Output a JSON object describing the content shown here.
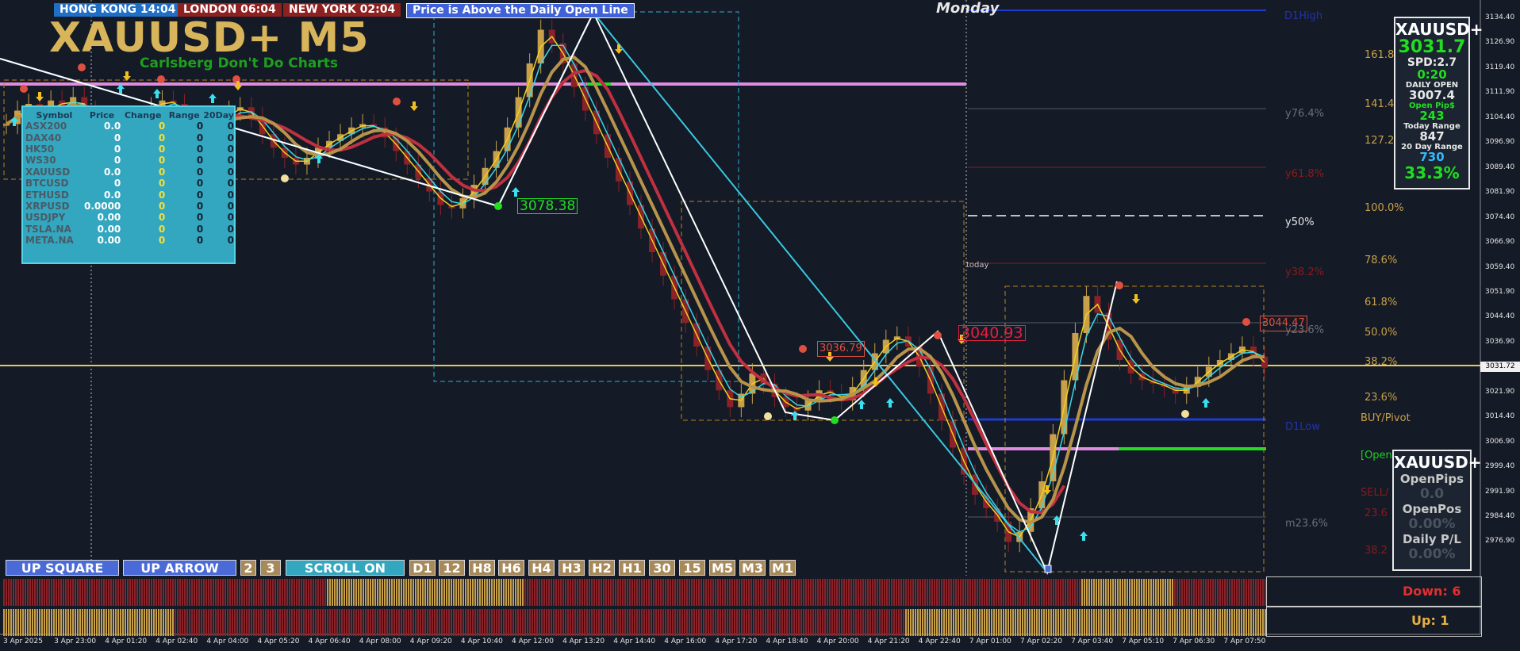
{
  "chart": {
    "symbol_title": "XAUUSD+ M5",
    "tagline": "Carlsberg Don't Do Charts",
    "day_label": "Monday",
    "today_label": "today",
    "current_price_label": "3031.72"
  },
  "sessions": [
    {
      "label": "HONG KONG 14:04",
      "color": "#1f6fc6"
    },
    {
      "label": "LONDON  06:04",
      "color": "#8e2020"
    },
    {
      "label": "NEW YORK  02:04",
      "color": "#8e2020"
    },
    {
      "label": "Price is Above the Daily Open Line",
      "color": "#4062d8"
    }
  ],
  "market_table": {
    "headers": [
      "Symbol",
      "Price",
      "Change",
      "Range",
      "20Day"
    ],
    "rows": [
      {
        "symbol": "ASX200",
        "price": "0.0",
        "change": "0",
        "range": "0",
        "day20": "0"
      },
      {
        "symbol": "DAX40",
        "price": "0",
        "change": "0",
        "range": "0",
        "day20": "0"
      },
      {
        "symbol": "HK50",
        "price": "0",
        "change": "0",
        "range": "0",
        "day20": "0"
      },
      {
        "symbol": "WS30",
        "price": "0",
        "change": "0",
        "range": "0",
        "day20": "0"
      },
      {
        "symbol": "XAUUSD",
        "price": "0.0",
        "change": "0",
        "range": "0",
        "day20": "0"
      },
      {
        "symbol": "BTCUSD",
        "price": "0",
        "change": "0",
        "range": "0",
        "day20": "0"
      },
      {
        "symbol": "ETHUSD",
        "price": "0.0",
        "change": "0",
        "range": "0",
        "day20": "0"
      },
      {
        "symbol": "XRPUSD",
        "price": "0.0000",
        "change": "0",
        "range": "0",
        "day20": "0"
      },
      {
        "symbol": "USDJPY",
        "price": "0.00",
        "change": "0",
        "range": "0",
        "day20": "0"
      },
      {
        "symbol": "TSLA.NA",
        "price": "0.00",
        "change": "0",
        "range": "0",
        "day20": "0"
      },
      {
        "symbol": "META.NA",
        "price": "0.00",
        "change": "0",
        "range": "0",
        "day20": "0"
      }
    ]
  },
  "info_panel": {
    "symbol": "XAUUSD+",
    "price": "3031.7",
    "spread": "SPD:2.7",
    "timer": "0:20",
    "daily_open_label": "DAILY OPEN",
    "daily_open": "3007.4",
    "open_pips_label": "Open Pip$",
    "open_pips": "243",
    "today_range_label": "Today Range",
    "today_range": "847",
    "day20_range_label": "20 Day Range",
    "day20_range": "730",
    "percent": "33.3%"
  },
  "position_panel": {
    "symbol": "XAUUSD+",
    "open_pips_label": "OpenPips",
    "open_pips": "0.0",
    "open_pos_label": "OpenPos",
    "open_pos": "0.00%",
    "daily_pl_label": "Daily P/L",
    "daily_pl": "0.00%"
  },
  "toolbar": {
    "mode_buttons": [
      "UP SQUARE",
      "UP ARROW",
      "2",
      "3",
      "SCROLL ON"
    ],
    "timeframes": [
      "D1",
      "12",
      "H8",
      "H6",
      "H4",
      "H3",
      "H2",
      "H1",
      "30",
      "15",
      "M5",
      "M3",
      "M1"
    ]
  },
  "strength": {
    "down_label": "Down: 6",
    "up_label": "Up: 1"
  },
  "price_axis": {
    "labels": [
      "3134.40",
      "3126.90",
      "3119.40",
      "3111.90",
      "3104.40",
      "3096.90",
      "3089.40",
      "3081.90",
      "3074.40",
      "3066.90",
      "3059.40",
      "3051.90",
      "3044.40",
      "3036.90",
      "3029.40",
      "3021.90",
      "3014.40",
      "3006.90",
      "2999.40",
      "2991.90",
      "2984.40",
      "2976.90"
    ]
  },
  "time_axis": {
    "labels": [
      "3 Apr 2025",
      "3 Apr 23:00",
      "4 Apr 01:20",
      "4 Apr 02:40",
      "4 Apr 04:00",
      "4 Apr 05:20",
      "4 Apr 06:40",
      "4 Apr 08:00",
      "4 Apr 09:20",
      "4 Apr 10:40",
      "4 Apr 12:00",
      "4 Apr 13:20",
      "4 Apr 14:40",
      "4 Apr 16:00",
      "4 Apr 17:20",
      "4 Apr 18:40",
      "4 Apr 20:00",
      "4 Apr 21:20",
      "4 Apr 22:40",
      "7 Apr 01:00",
      "7 Apr 02:20",
      "7 Apr 03:40",
      "7 Apr 05:10",
      "7 Apr 06:30",
      "7 Apr 07:50"
    ]
  },
  "fib_levels": [
    {
      "label": "D1High",
      "color": "#2233aa"
    },
    {
      "label": "161.8",
      "color": "#c8a04a"
    },
    {
      "label": "y76.4%",
      "color": "#6b7078"
    },
    {
      "label": "141.4",
      "color": "#c8a04a"
    },
    {
      "label": "127.2",
      "color": "#c8a04a"
    },
    {
      "label": "y61.8%",
      "color": "#8a1a1a"
    },
    {
      "label": "100.0%",
      "color": "#c8a04a"
    },
    {
      "label": "y50%",
      "color": "#e8e8e8"
    },
    {
      "label": "78.6%",
      "color": "#c8a04a"
    },
    {
      "label": "y38.2%",
      "color": "#8a1a1a"
    },
    {
      "label": "61.8%",
      "color": "#c8a04a"
    },
    {
      "label": "50.0%",
      "color": "#c8a04a"
    },
    {
      "label": "y23.6%",
      "color": "#6b7078"
    },
    {
      "label": "38.2%",
      "color": "#c8a04a"
    },
    {
      "label": "23.6%",
      "color": "#c8a04a"
    },
    {
      "label": "BUY/Pivot",
      "color": "#c8a04a"
    },
    {
      "label": "D1Low",
      "color": "#2233aa"
    },
    {
      "label": "[Open",
      "color": "#1ed01e"
    },
    {
      "label": "SELL/",
      "color": "#8a1a1a"
    },
    {
      "label": "m23.6%",
      "color": "#6b7078"
    },
    {
      "label": "23.6",
      "color": "#8a1a1a"
    },
    {
      "label": "38.2",
      "color": "#8a1a1a"
    }
  ],
  "price_labels": [
    {
      "text": "3078.38",
      "color": "#22dd22"
    },
    {
      "text": "3036.79",
      "color": "#e05040"
    },
    {
      "text": "3040.93",
      "color": "#e02040"
    },
    {
      "text": "3044.47",
      "color": "#e05040"
    }
  ],
  "chart_data": {
    "type": "candlestick",
    "symbol": "XAUUSD+",
    "timeframe": "M5",
    "y_range": [
      2970,
      3138
    ],
    "close_series": [
      3104,
      3108,
      3110,
      3106,
      3111,
      3109,
      3112,
      3108,
      3104,
      3101,
      3099,
      3103,
      3106,
      3109,
      3111,
      3110,
      3106,
      3104,
      3103,
      3105,
      3108,
      3109,
      3106,
      3101,
      3097,
      3094,
      3092,
      3094,
      3097,
      3099,
      3101,
      3103,
      3104,
      3103,
      3100,
      3096,
      3092,
      3088,
      3084,
      3080,
      3079,
      3082,
      3086,
      3091,
      3096,
      3103,
      3112,
      3122,
      3132,
      3128,
      3122,
      3115,
      3108,
      3101,
      3094,
      3087,
      3080,
      3073,
      3066,
      3059,
      3052,
      3045,
      3038,
      3031,
      3025,
      3020,
      3024,
      3030,
      3027,
      3023,
      3020,
      3019,
      3022,
      3025,
      3024,
      3022,
      3026,
      3031,
      3036,
      3040,
      3041,
      3038,
      3032,
      3024,
      3016,
      3008,
      3000,
      2994,
      2990,
      2986,
      2980,
      2983,
      2990,
      2998,
      3012,
      3028,
      3042,
      3053,
      3048,
      3040,
      3034,
      3030,
      3028,
      3027,
      3026,
      3024,
      3026,
      3029,
      3032,
      3034,
      3036,
      3038,
      3035,
      3031.7
    ],
    "key_levels": {
      "current_price": 3031.72,
      "daily_open": 3007.4,
      "swing_high_label": 3078.38,
      "swing_labels": [
        3036.79,
        3040.93,
        3044.47
      ]
    }
  }
}
